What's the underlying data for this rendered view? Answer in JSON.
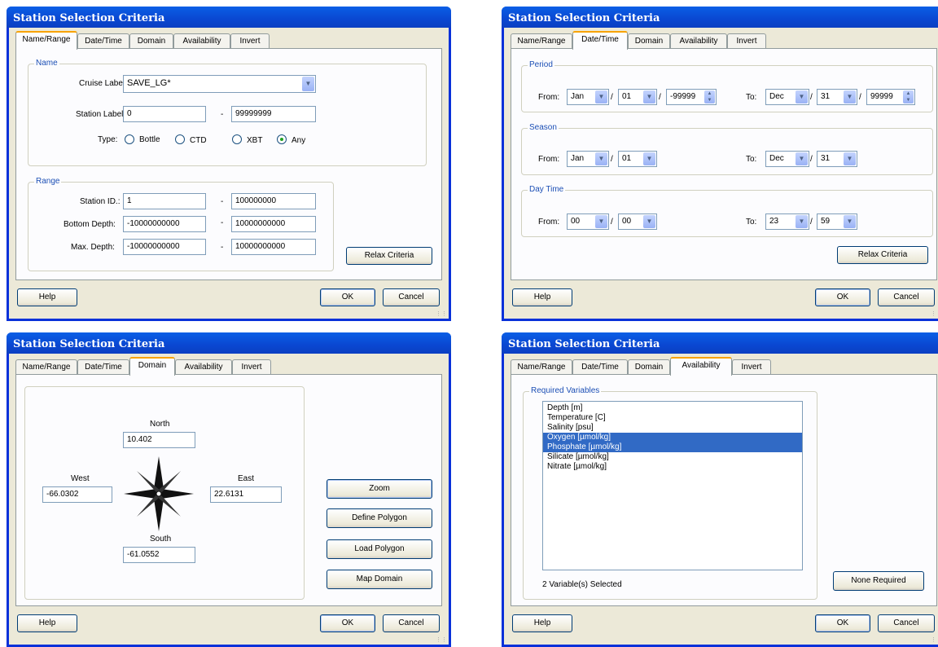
{
  "title": "Station Selection Criteria",
  "tabs": [
    "Name/Range",
    "Date/Time",
    "Domain",
    "Availability",
    "Invert"
  ],
  "buttons": {
    "help": "Help",
    "ok": "OK",
    "cancel": "Cancel",
    "relax": "Relax Criteria"
  },
  "name_range": {
    "name_group": "Name",
    "cruise_label": "Cruise Label:",
    "cruise_value": "SAVE_LG*",
    "station_label": "Station Label:",
    "station_from": "0",
    "station_to": "99999999",
    "dash": "-",
    "type_label": "Type:",
    "types": [
      "Bottle",
      "CTD",
      "XBT",
      "Any"
    ],
    "type_selected": "Any",
    "range_group": "Range",
    "station_id_label": "Station ID.:",
    "station_id_from": "1",
    "station_id_to": "100000000",
    "bottom_depth_label": "Bottom Depth:",
    "bottom_depth_from": "-10000000000",
    "bottom_depth_to": "10000000000",
    "max_depth_label": "Max. Depth:",
    "max_depth_from": "-10000000000",
    "max_depth_to": "10000000000"
  },
  "date_time": {
    "period_group": "Period",
    "season_group": "Season",
    "daytime_group": "Day Time",
    "from_label": "From:",
    "to_label": "To:",
    "slash": "/",
    "period_from": {
      "month": "Jan",
      "day": "01",
      "year": "-99999"
    },
    "period_to": {
      "month": "Dec",
      "day": "31",
      "year": "99999"
    },
    "season_from": {
      "month": "Jan",
      "day": "01"
    },
    "season_to": {
      "month": "Dec",
      "day": "31"
    },
    "daytime_from": {
      "hour": "00",
      "minute": "00"
    },
    "daytime_to": {
      "hour": "23",
      "minute": "59"
    }
  },
  "domain": {
    "north_label": "North",
    "north": "10.402",
    "west_label": "West",
    "west": "-66.0302",
    "east_label": "East",
    "east": "22.6131",
    "south_label": "South",
    "south": "-61.0552",
    "zoom": "Zoom",
    "define_polygon": "Define Polygon",
    "load_polygon": "Load Polygon",
    "map_domain": "Map Domain"
  },
  "availability": {
    "group": "Required Variables",
    "variables": [
      {
        "label": "Depth [m]",
        "selected": false
      },
      {
        "label": "Temperature [C]",
        "selected": false
      },
      {
        "label": "Salinity [psu]",
        "selected": false
      },
      {
        "label": "Oxygen [µmol/kg]",
        "selected": true
      },
      {
        "label": "Phosphate [µmol/kg]",
        "selected": true
      },
      {
        "label": "Silicate [µmol/kg]",
        "selected": false
      },
      {
        "label": "Nitrate [µmol/kg]",
        "selected": false
      }
    ],
    "status": "2 Variable(s) Selected",
    "none_required": "None Required"
  }
}
